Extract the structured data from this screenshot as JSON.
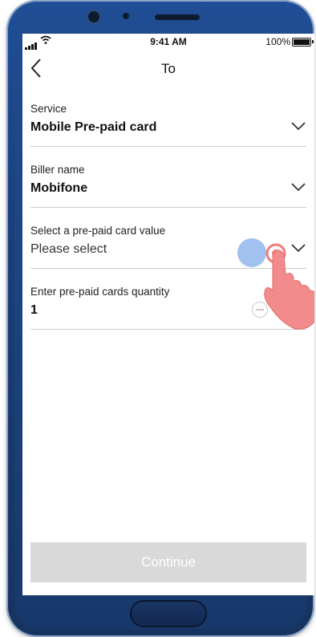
{
  "status_bar": {
    "time": "9:41 AM",
    "battery": "100%"
  },
  "nav": {
    "title": "To"
  },
  "fields": [
    {
      "label": "Service",
      "value": "Mobile Pre-paid card"
    },
    {
      "label": "Biller name",
      "value": "Mobifone"
    },
    {
      "label": "Select a pre-paid card value",
      "placeholder": "Please select"
    },
    {
      "label": "Enter pre-paid cards quantity",
      "value": "1"
    }
  ],
  "actions": {
    "continue_label": "Continue"
  },
  "colors": {
    "phone_frame": "#1f4f98",
    "button_disabled": "#d9d9d9",
    "tap_indicator": "#6ea0e6",
    "hand": "#f07b7b"
  },
  "icons": [
    "back-chevron-icon",
    "chevron-down-icon",
    "minus-circle-icon",
    "hand-pointer-icon"
  ]
}
